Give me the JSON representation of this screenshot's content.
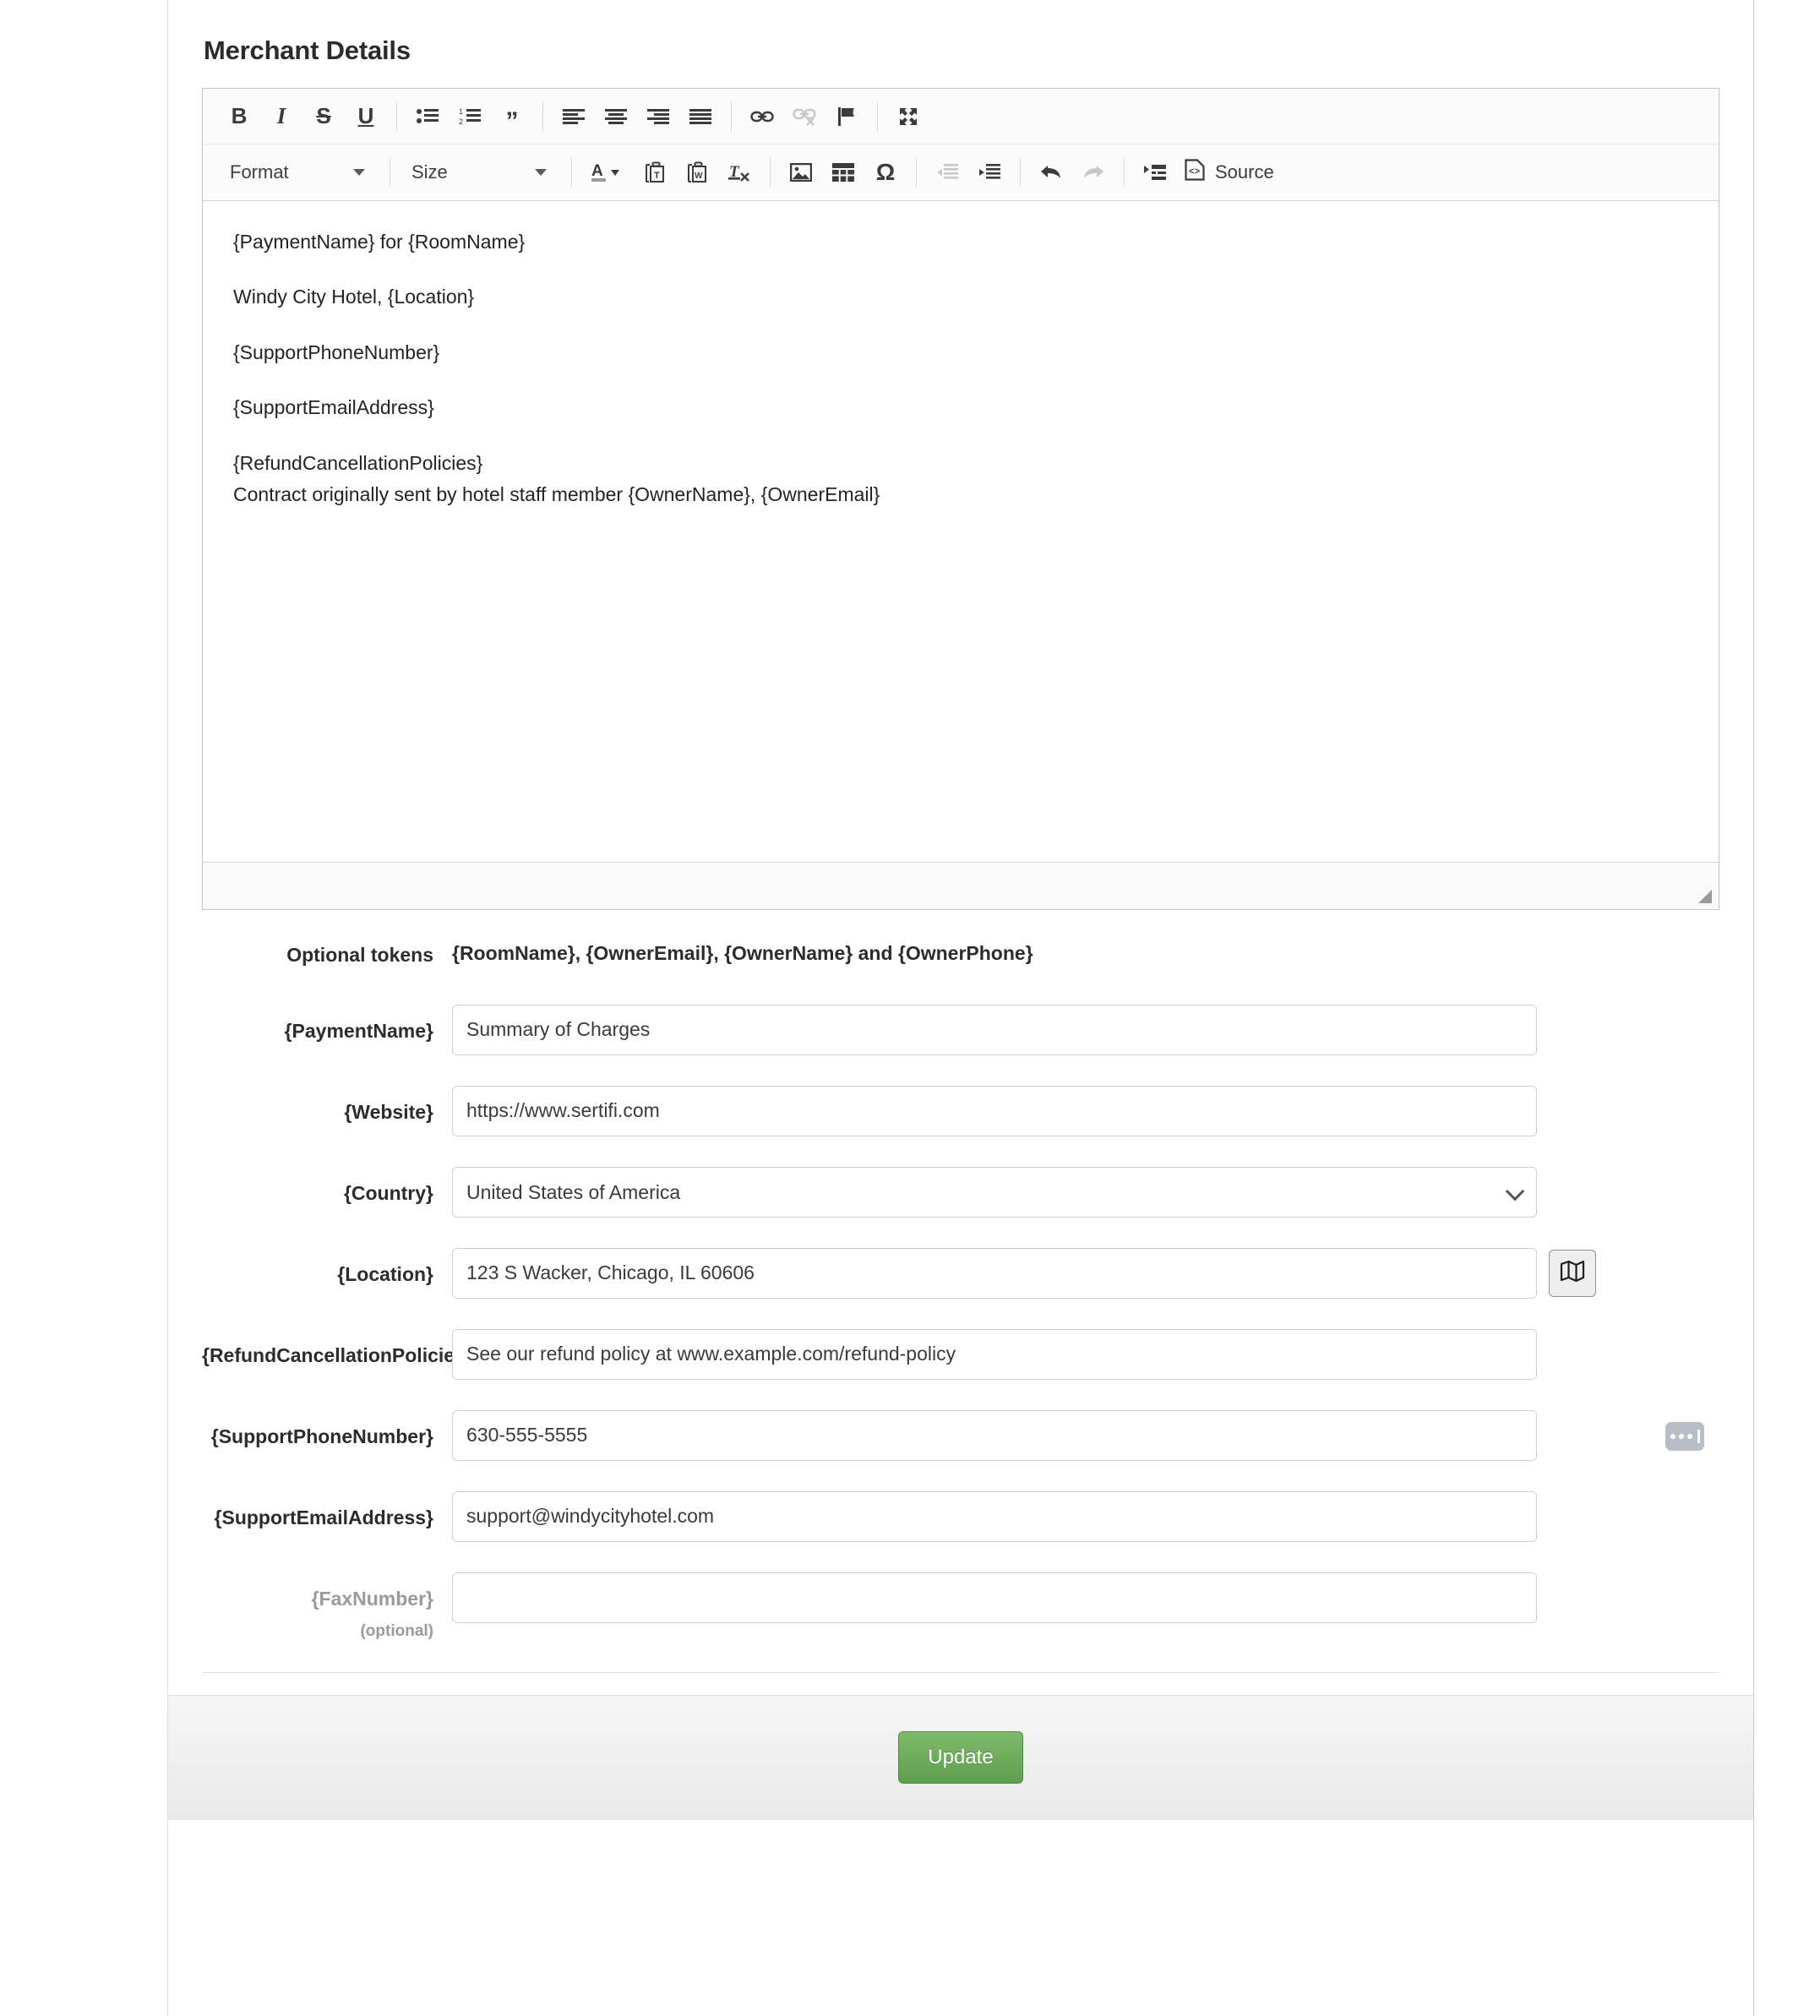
{
  "page": {
    "title": "Merchant Details"
  },
  "editor": {
    "toolbar_row1": [
      {
        "name": "bold-icon",
        "label": "B"
      },
      {
        "name": "italic-icon",
        "label": "I"
      },
      {
        "name": "strikethrough-icon",
        "label": "S"
      },
      {
        "name": "underline-icon",
        "label": "U"
      },
      {
        "name": "bulleted-list-icon",
        "label": "Insert/Remove Bulleted List"
      },
      {
        "name": "numbered-list-icon",
        "label": "Insert/Remove Numbered List"
      },
      {
        "name": "blockquote-icon",
        "label": "Block Quote"
      },
      {
        "name": "align-left-icon",
        "label": "Align Left"
      },
      {
        "name": "align-center-icon",
        "label": "Center"
      },
      {
        "name": "align-right-icon",
        "label": "Align Right"
      },
      {
        "name": "justify-icon",
        "label": "Justify"
      },
      {
        "name": "link-icon",
        "label": "Link"
      },
      {
        "name": "unlink-icon",
        "label": "Unlink"
      },
      {
        "name": "flag-icon",
        "label": "Anchor"
      },
      {
        "name": "maximize-icon",
        "label": "Maximize"
      }
    ],
    "format_select": {
      "label": "Format"
    },
    "size_select": {
      "label": "Size"
    },
    "toolbar_row2": [
      {
        "name": "text-color-icon",
        "label": "Text Color"
      },
      {
        "name": "paste-as-text-icon",
        "label": "Paste as plain text"
      },
      {
        "name": "paste-from-word-icon",
        "label": "Paste from Word"
      },
      {
        "name": "remove-format-icon",
        "label": "Remove Format"
      },
      {
        "name": "image-icon",
        "label": "Image"
      },
      {
        "name": "table-icon",
        "label": "Table"
      },
      {
        "name": "special-character-icon",
        "label": "Insert Special Character"
      },
      {
        "name": "outdent-icon",
        "label": "Decrease Indent"
      },
      {
        "name": "indent-icon",
        "label": "Increase Indent"
      },
      {
        "name": "undo-icon",
        "label": "Undo"
      },
      {
        "name": "redo-icon",
        "label": "Redo"
      },
      {
        "name": "templates-icon",
        "label": "Templates"
      }
    ],
    "source_button": {
      "label": "Source",
      "icon": "source-code-icon"
    },
    "content_lines": [
      "{PaymentName} for {RoomName}",
      "Windy City Hotel, {Location}",
      "{SupportPhoneNumber}",
      "{SupportEmailAddress}",
      "{RefundCancellationPolicies}",
      "Contract originally sent by hotel staff member {OwnerName}, {OwnerEmail}"
    ]
  },
  "form": {
    "optional_tokens": {
      "label": "Optional tokens",
      "value": "{RoomName}, {OwnerEmail}, {OwnerName} and {OwnerPhone}"
    },
    "payment_name": {
      "label": "{PaymentName}",
      "value": "Summary of Charges",
      "placeholder": ""
    },
    "website": {
      "label": "{Website}",
      "value": "https://www.sertifi.com",
      "placeholder": ""
    },
    "country": {
      "label": "{Country}",
      "value": "United States of America",
      "options": [
        "United States of America"
      ]
    },
    "location": {
      "label": "{Location}",
      "value": "123 S Wacker, Chicago, IL 60606",
      "placeholder": "",
      "map_button_icon": "map-icon"
    },
    "refund_cancellation_policies": {
      "label": "{RefundCancellationPolicies}",
      "value": "See our refund policy at www.example.com/refund-policy",
      "placeholder": ""
    },
    "support_phone_number": {
      "label": "{SupportPhoneNumber}",
      "value": "630-555-5555",
      "placeholder": "",
      "hint_icon": "autofill-dots-icon"
    },
    "support_email_address": {
      "label": "{SupportEmailAddress}",
      "value": "support@windycityhotel.com",
      "placeholder": ""
    },
    "fax_number": {
      "label": "{FaxNumber}",
      "sublabel": "(optional)",
      "value": "",
      "placeholder": ""
    }
  },
  "footer": {
    "update_label": "Update"
  },
  "colors": {
    "accent_green": "#5f9e4f",
    "text": "#2c2c2c",
    "muted": "#9a9a9a",
    "border": "#cfcfcf"
  }
}
